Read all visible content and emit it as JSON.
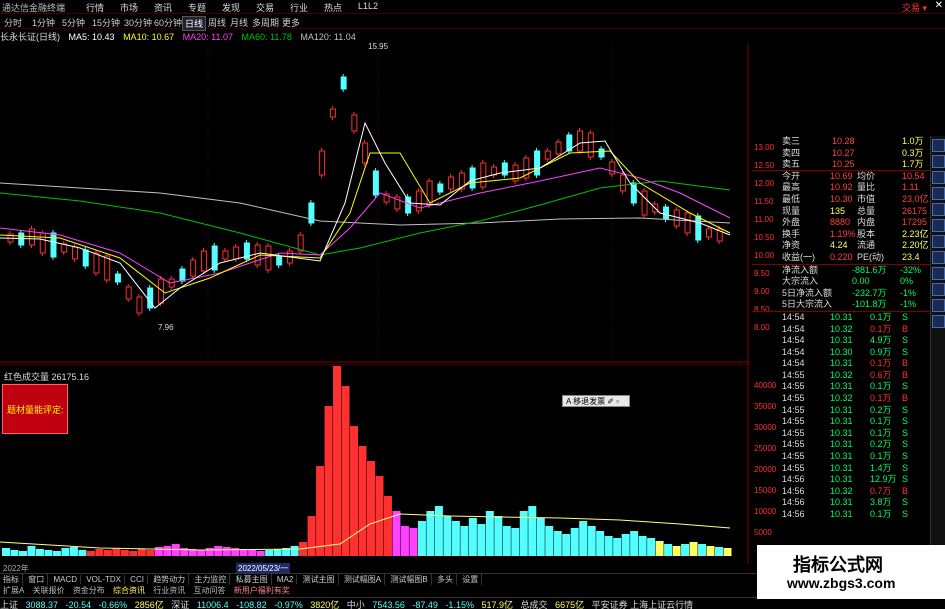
{
  "titlebar": {
    "app_title": "通达信金融终端",
    "menu": [
      "行情",
      "市场",
      "资讯",
      "专题",
      "发现",
      "交易",
      "行业",
      "热点",
      "L1L2"
    ],
    "right_label": "交易 ▾",
    "close": "✕"
  },
  "periods": [
    "分时",
    "1分钟",
    "5分钟",
    "15分钟",
    "30分钟",
    "60分钟",
    "日线",
    "周线",
    "月线",
    "多周期",
    "更多"
  ],
  "active_period": "日线",
  "indicators": {
    "stock": "长永长证(日线)",
    "ma5": "MA5: 10.43",
    "ma10": "MA10: 10.67",
    "ma20": "MA20: 11.07",
    "ma60": "MA60: 11.78",
    "ma120": "MA120: 11.04"
  },
  "price_labels": {
    "high": "15.95",
    "low": "7.96"
  },
  "volume": {
    "header": "红色成交量 26175.16",
    "redbox_text": "题材量能评定:",
    "popup": "A 移退发票 ✐ ▫"
  },
  "volume_axis": [
    "40000",
    "35000",
    "30000",
    "25000",
    "20000",
    "15000",
    "10000",
    "5000"
  ],
  "price_axis": [
    "13.00",
    "12.50",
    "12.00",
    "11.50",
    "11.00",
    "10.50",
    "10.00",
    "9.50",
    "9.00",
    "8.50",
    "8.00"
  ],
  "dates": {
    "left": "2022年",
    "selected": "2022/05/23/一"
  },
  "bottom_tabs": [
    "指标",
    "窗口",
    "MACD",
    "VOL-TDX",
    "CCI",
    "趋势动力",
    "主力监控",
    "私募主图",
    "MA2",
    "测试主图",
    "测试幅图A",
    "测试幅图B",
    "多头",
    "设置"
  ],
  "bottom_tabs2": [
    "扩展A",
    "关联报价",
    "资金分布",
    "综合资讯",
    "行业资讯",
    "互动问答",
    "新用户福利有奖"
  ],
  "status": {
    "sh_label": "上证",
    "sh_val": "3088.37",
    "sh_chg": "-20.54",
    "sh_pct": "-0.66%",
    "sh_amt": "2856亿",
    "sz_label": "深证",
    "sz_val": "11006.4",
    "sz_chg": "-108.82",
    "sz_pct": "-0.97%",
    "sz_amt": "3820亿",
    "zx_label": "中小",
    "zx_val": "7543.56",
    "zx_chg": "-87.49",
    "zx_pct": "-1.15%",
    "zx_amt": "517.9亿",
    "total_label": "总成交",
    "total_val": "6675亿",
    "broker": "平安证券 上海上证云行情"
  },
  "quote": {
    "asks": [
      {
        "label": "卖三",
        "price": "10.28",
        "vol": "1.0万"
      },
      {
        "label": "卖四",
        "price": "10.27",
        "vol": "0.3万"
      },
      {
        "label": "卖五",
        "price": "10.25",
        "vol": "1.7万"
      }
    ],
    "stats": [
      {
        "l1": "今开",
        "v1": "10.69",
        "l2": "均价",
        "v2": "10.54"
      },
      {
        "l1": "最高",
        "v1": "10.92",
        "l2": "量比",
        "v2": "1.11"
      },
      {
        "l1": "最低",
        "v1": "10.30",
        "l2": "市值",
        "v2": "23.0亿"
      },
      {
        "l1": "现量",
        "v1": "135",
        "l2": "总量",
        "v2": "26175"
      },
      {
        "l1": "外盘",
        "v1": "8880",
        "l2": "内盘",
        "v2": "17295"
      },
      {
        "l1": "换手",
        "v1": "1.19%",
        "l2": "股本",
        "v2": "2.23亿"
      },
      {
        "l1": "净资",
        "v1": "4.24",
        "l2": "流通",
        "v2": "2.20亿"
      },
      {
        "l1": "收益(一)",
        "v1": "0.220",
        "l2": "PE(动)",
        "v2": "23.4"
      }
    ],
    "flows": [
      {
        "label": "净流入额",
        "v1": "-881.6万",
        "v2": "-32%"
      },
      {
        "label": "大宗流入",
        "v1": "0.00",
        "v2": "0%"
      },
      {
        "label": "5日净流入额",
        "v1": "-232.7万",
        "v2": "-1%"
      },
      {
        "label": "5日大宗流入",
        "v1": "-101.8万",
        "v2": "-1%"
      }
    ]
  },
  "ticks": [
    {
      "t": "14:54",
      "p": "10.31",
      "v": "0.1万",
      "s": "S"
    },
    {
      "t": "14:54",
      "p": "10.32",
      "v": "0.1万",
      "s": "B"
    },
    {
      "t": "14:54",
      "p": "10.31",
      "v": "4.9万",
      "s": "S"
    },
    {
      "t": "14:54",
      "p": "10.30",
      "v": "0.9万",
      "s": "S"
    },
    {
      "t": "14:54",
      "p": "10.31",
      "v": "0.1万",
      "s": "B"
    },
    {
      "t": "14:55",
      "p": "10.32",
      "v": "0.6万",
      "s": "B"
    },
    {
      "t": "14:55",
      "p": "10.31",
      "v": "0.1万",
      "s": "S"
    },
    {
      "t": "14:55",
      "p": "10.32",
      "v": "0.1万",
      "s": "B"
    },
    {
      "t": "14:55",
      "p": "10.31",
      "v": "0.2万",
      "s": "S"
    },
    {
      "t": "14:55",
      "p": "10.31",
      "v": "0.1万",
      "s": "S"
    },
    {
      "t": "14:55",
      "p": "10.31",
      "v": "0.1万",
      "s": "S"
    },
    {
      "t": "14:55",
      "p": "10.31",
      "v": "0.2万",
      "s": "S"
    },
    {
      "t": "14:55",
      "p": "10.31",
      "v": "0.1万",
      "s": "S"
    },
    {
      "t": "14:55",
      "p": "10.31",
      "v": "1.4万",
      "s": "S"
    },
    {
      "t": "14:56",
      "p": "10.31",
      "v": "12.9万",
      "s": "S"
    },
    {
      "t": "14:56",
      "p": "10.32",
      "v": "0.7万",
      "s": "B"
    },
    {
      "t": "14:56",
      "p": "10.31",
      "v": "3.8万",
      "s": "S"
    },
    {
      "t": "14:56",
      "p": "10.31",
      "v": "0.1万",
      "s": "S"
    }
  ],
  "watermark": {
    "line1": "指标公式网",
    "line2": "www.zbgs3.com"
  },
  "colors": {
    "up": "#ff3030",
    "down": "#54ffff",
    "ma5": "#ffffff",
    "ma10": "#ffff00",
    "ma20": "#ff40ff",
    "ma60": "#00c000",
    "ma120": "#c0c0c0",
    "vol_pink": "#ff40ff"
  }
}
